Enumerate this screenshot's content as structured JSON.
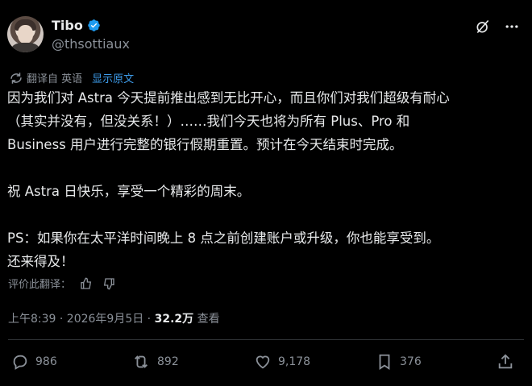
{
  "author": {
    "name": "Tibo",
    "handle": "@thsottiaux"
  },
  "translation": {
    "label": "翻译自 英语",
    "show_original": "显示原文"
  },
  "tweet": {
    "line1": "因为我们对 Astra 今天提前推出感到无比开心，而且你们对我们超级有耐心",
    "line2": "（其实并没有，但没关系！）……我们今天也将为所有 Plus、Pro 和",
    "line3": "Business 用户进行完整的银行假期重置。预计在今天结束时完成。",
    "line4": "祝 Astra 日快乐，享受一个精彩的周末。",
    "line5": "PS：如果你在太平洋时间晚上 8 点之前创建账户或升级，你也能享受到。",
    "line6": "还来得及！"
  },
  "rate_translation": {
    "label": "评价此翻译："
  },
  "meta": {
    "time": "上午8:39 · 2026年9月5日 · ",
    "views": "32.2万",
    "views_label": " 查看"
  },
  "actions": {
    "replies": "986",
    "reposts": "892",
    "likes": "9,178",
    "bookmarks": "376"
  },
  "colors": {
    "accent": "#1d9bf0",
    "text": "#e7e9ea",
    "muted": "#8b9199",
    "background": "#000000"
  },
  "icons": [
    "verified-badge-icon",
    "grok-icon",
    "more-icon",
    "translate-icon",
    "thumbs-up-icon",
    "thumbs-down-icon",
    "reply-icon",
    "repost-icon",
    "like-icon",
    "bookmark-icon",
    "share-icon"
  ]
}
